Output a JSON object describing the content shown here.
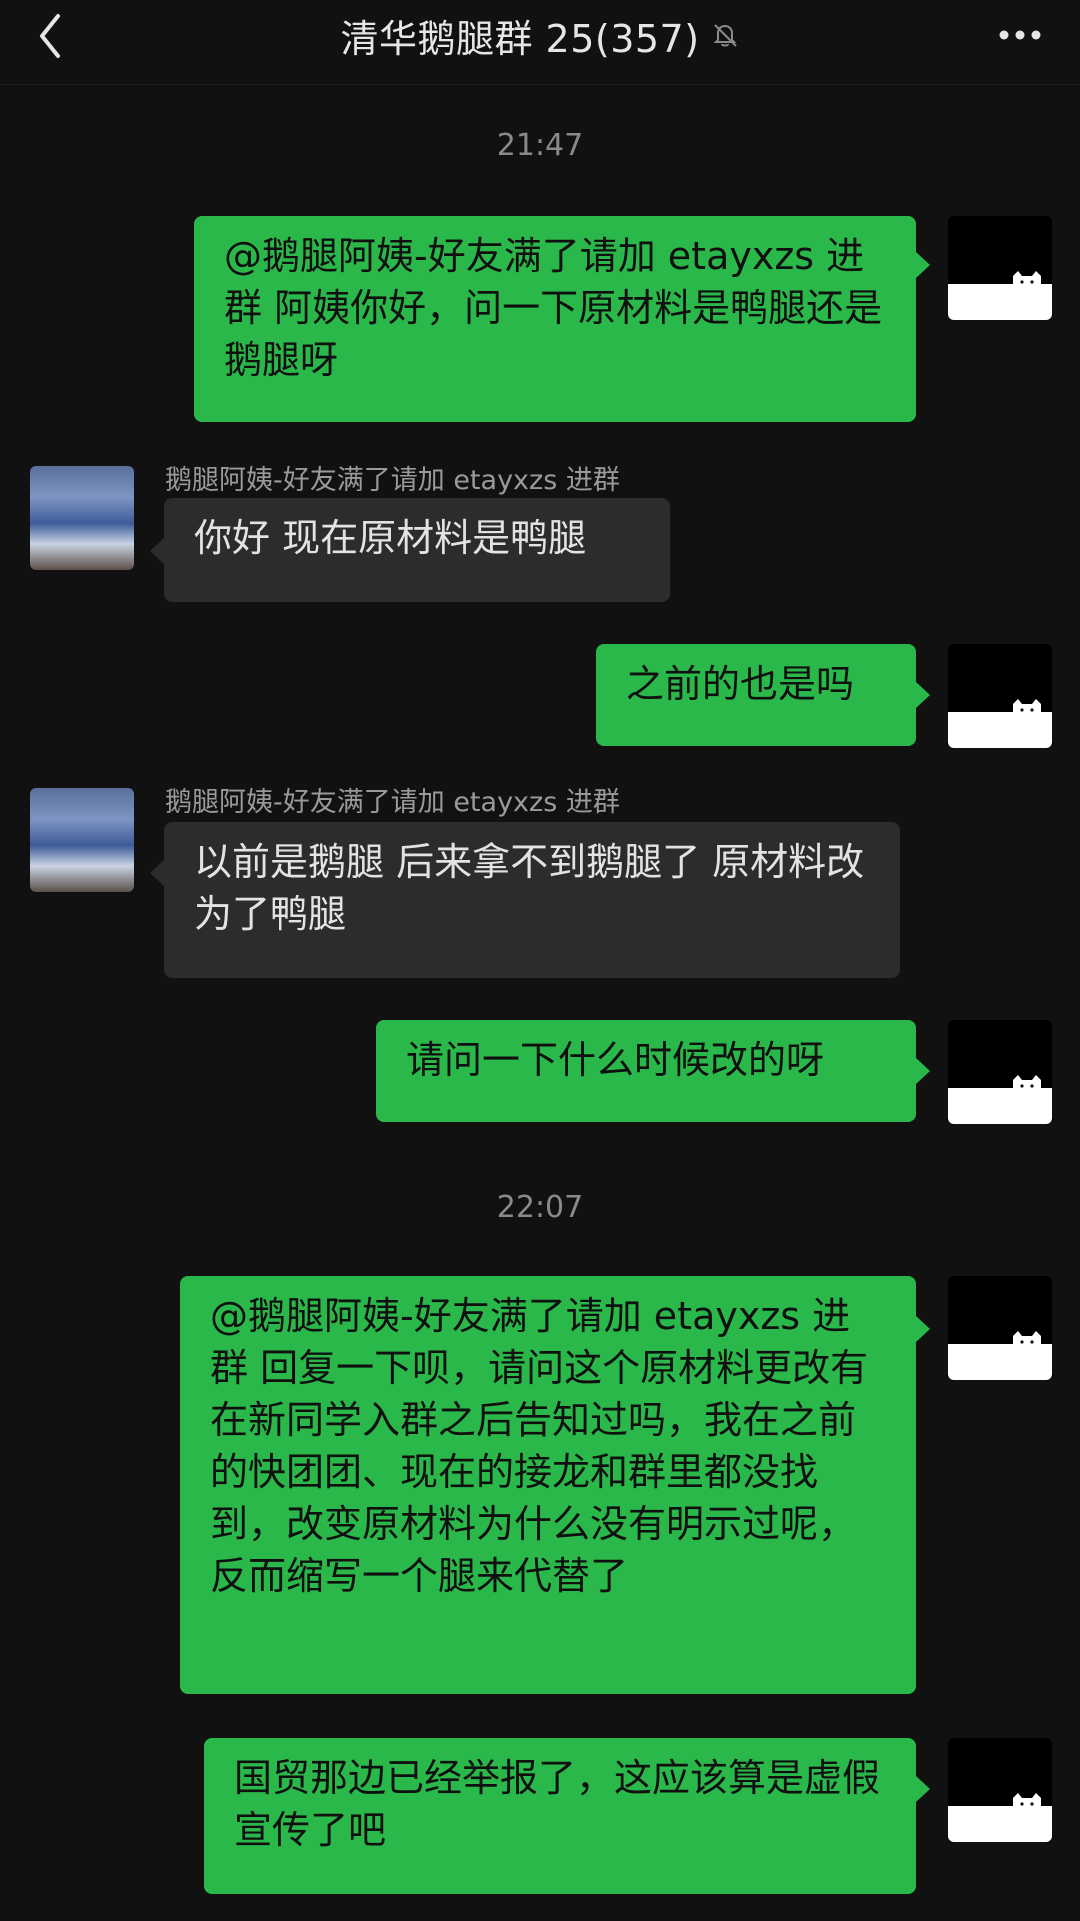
{
  "header": {
    "title": "清华鹅腿群 25(357)",
    "muted": true
  },
  "icons": {
    "back": "chevron-left-icon",
    "mute": "bell-off-icon",
    "more": "more-dots-icon"
  },
  "colors": {
    "self_bubble": "#2bb84a",
    "other_bubble": "#2c2c2c",
    "background": "#111111"
  },
  "timestamps": [
    "21:47",
    "22:07"
  ],
  "messages": [
    {
      "from": "self",
      "text": "@鹅腿阿姨-好友满了请加 etayxzs 进群 阿姨你好，问一下原材料是鸭腿还是鹅腿呀"
    },
    {
      "from": "other",
      "sender": "鹅腿阿姨-好友满了请加 etayxzs 进群",
      "text": "你好 现在原材料是鸭腿"
    },
    {
      "from": "self",
      "text": "之前的也是吗"
    },
    {
      "from": "other",
      "sender": "鹅腿阿姨-好友满了请加 etayxzs 进群",
      "text": "以前是鹅腿 后来拿不到鹅腿了 原材料改为了鸭腿"
    },
    {
      "from": "self",
      "text": "请问一下什么时候改的呀"
    },
    {
      "from": "self",
      "text": "@鹅腿阿姨-好友满了请加 etayxzs 进群 回复一下呗，请问这个原材料更改有在新同学入群之后告知过吗，我在之前的快团团、现在的接龙和群里都没找到，改变原材料为什么没有明示过呢，反而缩写一个腿来代替了"
    },
    {
      "from": "self",
      "text": "国贸那边已经举报了，这应该算是虚假宣传了吧"
    }
  ]
}
